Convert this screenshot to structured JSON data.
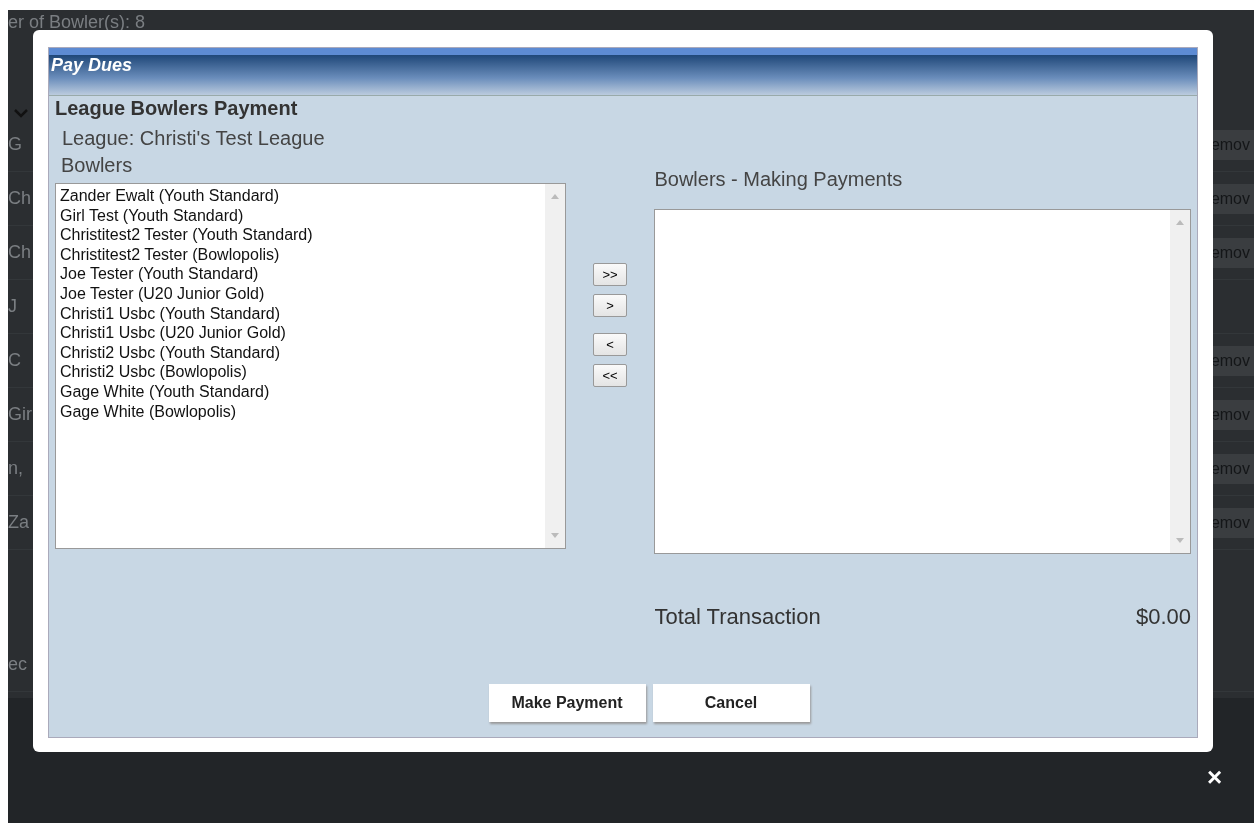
{
  "background_page": {
    "header_text": "er of Bowler(s): 8",
    "rows": [
      {
        "name": "G",
        "action": "emov"
      },
      {
        "name": "Ch",
        "action": "emov"
      },
      {
        "name": "Ch",
        "action": "emov"
      },
      {
        "name": "J"
      },
      {
        "name": "C",
        "action": "emov"
      },
      {
        "name": "Gir",
        "action": "emov"
      },
      {
        "name": "n,",
        "action": "emov"
      },
      {
        "name": "Za",
        "action": "emov"
      },
      {
        "name": "ec"
      }
    ]
  },
  "dialog": {
    "title": "Pay Dues",
    "heading": "League Bowlers Payment",
    "league": "League: Christi's Test League",
    "available": {
      "label": "Bowlers",
      "items": [
        "Zander Ewalt (Youth Standard)",
        "Girl Test (Youth Standard)",
        "Christitest2 Tester (Youth Standard)",
        "Christitest2 Tester (Bowlopolis)",
        "Joe Tester (Youth Standard)",
        "Joe Tester (U20 Junior Gold)",
        "Christi1 Usbc (Youth Standard)",
        "Christi1 Usbc (U20 Junior Gold)",
        "Christi2 Usbc (Youth Standard)",
        "Christi2 Usbc (Bowlopolis)",
        "Gage White (Youth Standard)",
        "Gage White (Bowlopolis)"
      ]
    },
    "move_buttons": [
      ">>",
      ">",
      "<",
      "<<"
    ],
    "paying": {
      "label": "Bowlers - Making Payments"
    },
    "total": {
      "label": "Total Transaction",
      "value": "$0.00"
    },
    "buttons": [
      "Make Payment",
      "Cancel"
    ]
  },
  "close": "×"
}
